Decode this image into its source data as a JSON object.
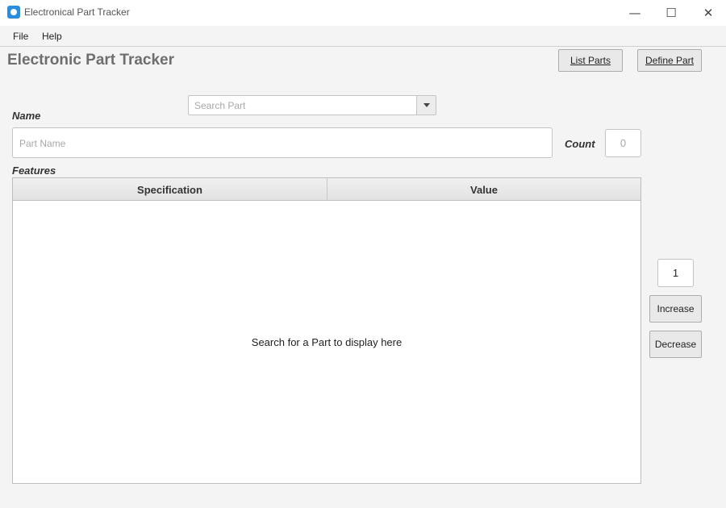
{
  "window": {
    "title": "Electronical Part Tracker",
    "app_icon": "app-icon",
    "controls": {
      "minimize": "—",
      "maximize": "☐",
      "close": "✕"
    }
  },
  "menu": {
    "items": [
      "File",
      "Help"
    ]
  },
  "header": {
    "title": "Electronic Part Tracker",
    "list_parts_label": "List Parts",
    "define_part_label": "Define Part"
  },
  "search": {
    "placeholder": "Search Part"
  },
  "form": {
    "name_label": "Name",
    "name_placeholder": "Part Name",
    "count_label": "Count",
    "count_value": "0",
    "features_label": "Features"
  },
  "table": {
    "columns": [
      "Specification",
      "Value"
    ],
    "placeholder": "Search for a Part to display here",
    "rows": []
  },
  "quantity": {
    "value": "1",
    "increase_label": "Increase",
    "decrease_label": "Decrease"
  },
  "colors": {
    "accent": "#2a8ee0",
    "background": "#f4f4f4",
    "title_gray": "#6e6e6e"
  }
}
